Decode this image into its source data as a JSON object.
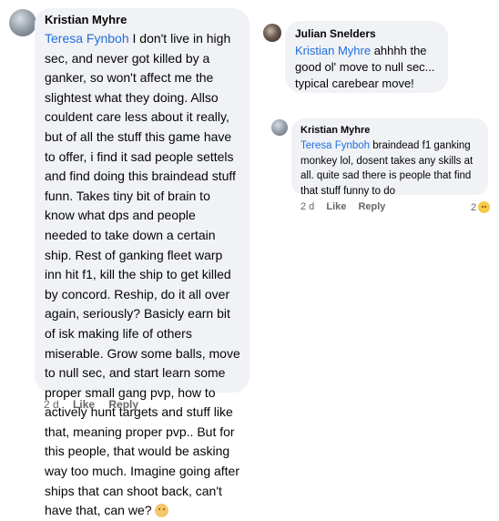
{
  "comments": {
    "kristian_long": {
      "author": "Kristian Myhre",
      "mention": "Teresa Fynboh",
      "body": " I don't live in high sec, and never got killed by a ganker, so won't affect me the slightest what they doing. Allso couldent care less about it really, but of all the stuff this game have to offer, i find it sad people settels and find doing this braindead stuff funn. Takes tiny bit of brain to know what dps and people needed to take down a certain ship. Rest of ganking fleet warp inn hit f1, kill the ship to get killed by concord. Reship, do it all over again, seriously? Basicly earn bit of isk making life of others miserable. Grow some balls, move to null sec, and start learn some proper small gang pvp, how to actively hunt targets and stuff like that, meaning proper pvp.. But for this people, that would be asking way too much. Imagine going after ships that can shoot back, can't have that, can we? ",
      "emoji_icon": "monkey-face-icon",
      "time": "2 d",
      "like": "Like",
      "reply": "Reply"
    },
    "julian": {
      "author": "Julian Snelders",
      "mention": "Kristian Myhre",
      "body": " ahhhh the good ol' move to null sec... typical carebear move!"
    },
    "kristian_short": {
      "author": "Kristian Myhre",
      "mention": "Teresa Fynboh",
      "body": "  braindead f1 ganking monkey lol, dosent takes any skills at all. quite sad there is people that find that stuff funny to do",
      "time": "2 d",
      "like": "Like",
      "reply": "Reply",
      "reaction_count": "2",
      "reaction_icon": "laughing-emoji-icon"
    }
  }
}
